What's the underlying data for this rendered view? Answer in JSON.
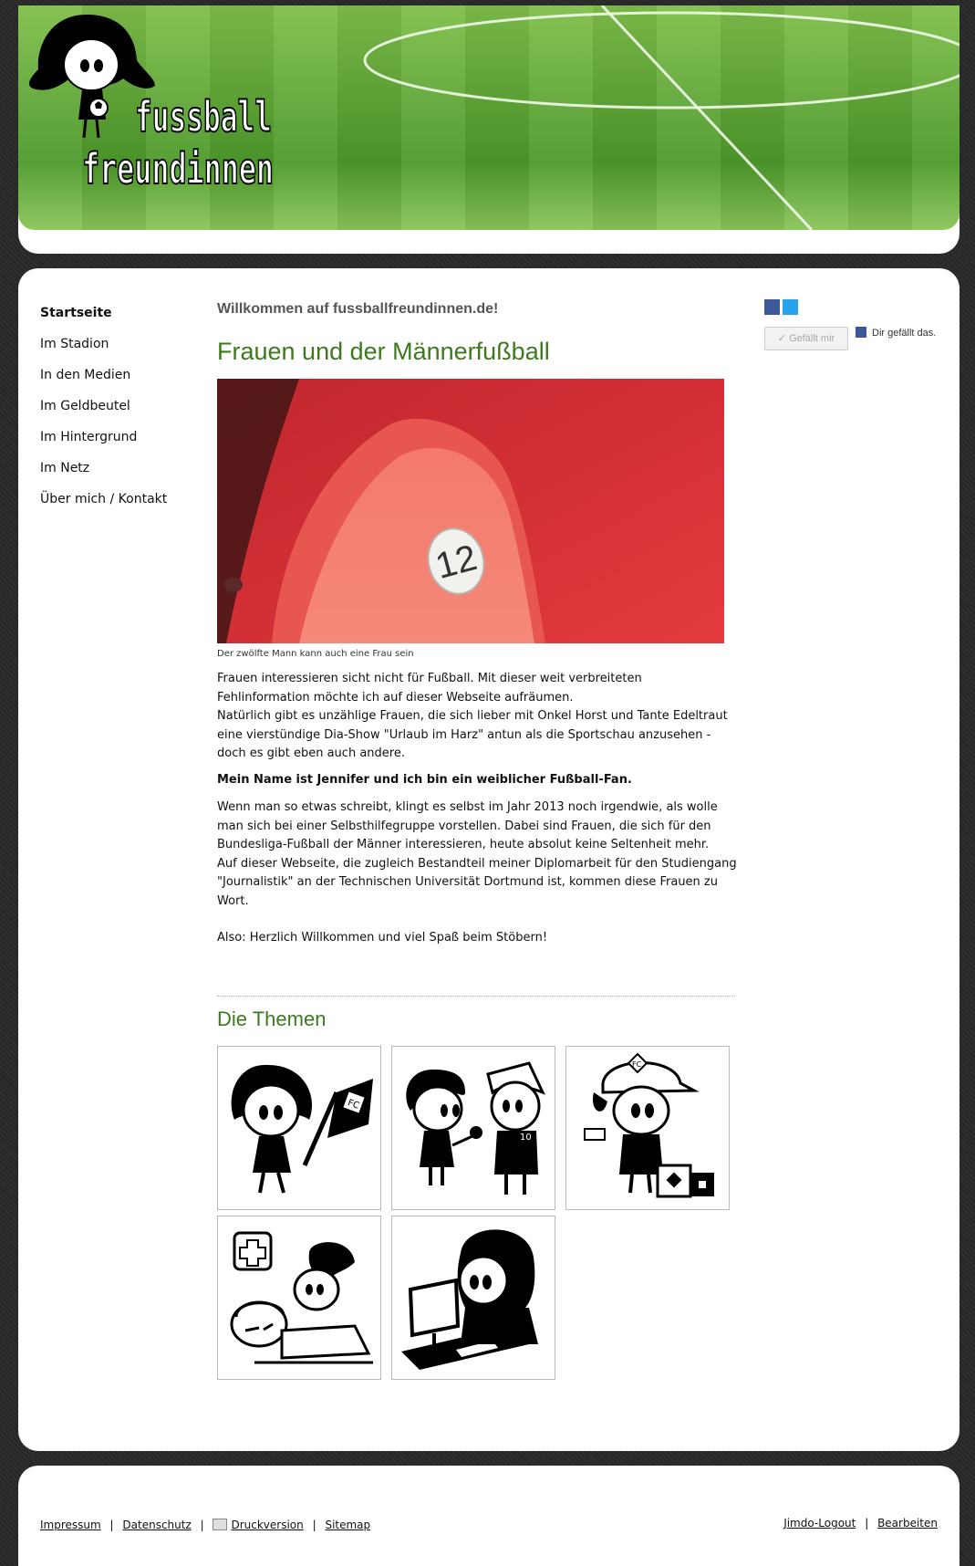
{
  "header": {
    "logo_line1": "fussball",
    "logo_line2": "freundinnen"
  },
  "nav": {
    "items": [
      {
        "label": "Startseite",
        "active": true
      },
      {
        "label": "Im Stadion"
      },
      {
        "label": "In den Medien"
      },
      {
        "label": "Im Geldbeutel"
      },
      {
        "label": "Im Hintergrund"
      },
      {
        "label": "Im Netz"
      },
      {
        "label": "Über mich / Kontakt"
      }
    ]
  },
  "content": {
    "welcome": "Willkommen auf fussballfreundinnen.de!",
    "headline": "Frauen und der Männerfußball",
    "photo_seat_number": "12",
    "photo_caption": "Der zwölfte Mann kann auch eine Frau sein",
    "para1": "Frauen interessieren sicht nicht für Fußball. Mit dieser weit verbreiteten Fehlinformation möchte ich auf dieser Webseite aufräumen.",
    "para2": "Natürlich gibt es unzählige Frauen, die sich lieber mit Onkel Horst und Tante Edeltraut eine vierstündige Dia-Show \"Urlaub im Harz\" antun als die Sportschau anzusehen - doch es gibt eben auch andere.",
    "bold": "Mein Name ist Jennifer und ich bin ein weiblicher Fußball-Fan.",
    "para3": "Wenn man so etwas schreibt, klingt es selbst im Jahr 2013 noch irgendwie, als wolle man sich bei einer Selbsthilfegruppe vorstellen. Dabei sind Frauen, die sich für den Bundesliga-Fußball der Männer interessieren, heute absolut keine Seltenheit mehr.",
    "para4": "Auf dieser Webseite, die zugleich Bestandteil meiner Diplomarbeit für den Studiengang \"Journalistik\" an der Technischen Universität Dortmund ist, kommen diese Frauen zu Wort.",
    "para5": "Also: Herzlich Willkommen und viel Spaß beim Stöbern!",
    "themen_title": "Die Themen",
    "tile_badge_fc": "FC",
    "tile_shirt_number": "10"
  },
  "social": {
    "like_button": "✓ Gefällt mir",
    "like_info": "Dir gefällt das."
  },
  "footer": {
    "impressum": "Impressum",
    "datenschutz": "Datenschutz",
    "druckversion": "Druckversion",
    "sitemap": "Sitemap",
    "sep": "|",
    "logout": "Jimdo-Logout",
    "bearbeiten": "Bearbeiten"
  },
  "colors": {
    "accent_green": "#3d7a1e",
    "facebook": "#3b5998",
    "twitter": "#2aa3ef"
  }
}
